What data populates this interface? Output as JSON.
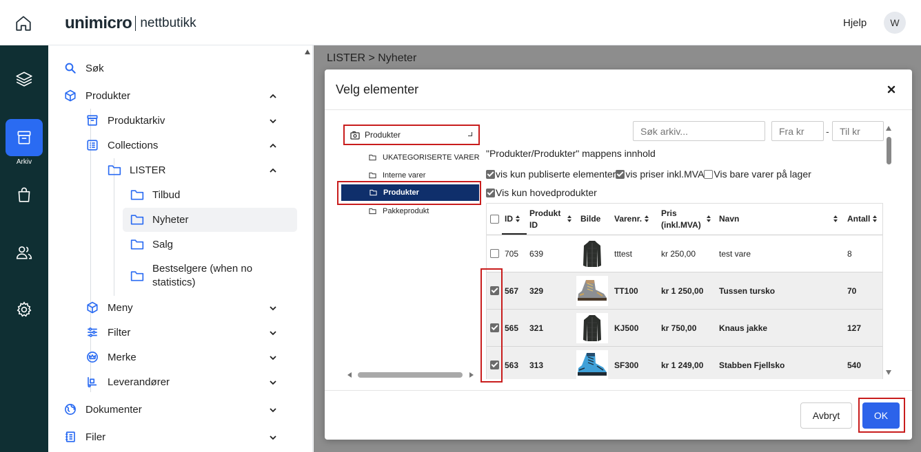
{
  "app": {
    "logo_brand": "unimicro",
    "logo_sub": "nettbutikk",
    "help_label": "Hjelp",
    "avatar_initial": "W"
  },
  "rail": {
    "active_label": "Arkiv"
  },
  "sidebar": {
    "search": "Søk",
    "produkter": "Produkter",
    "produktarkiv": "Produktarkiv",
    "collections": "Collections",
    "lister": "LISTER",
    "tilbud": "Tilbud",
    "nyheter": "Nyheter",
    "salg": "Salg",
    "bestselgere": "Bestselgere (when no statistics)",
    "meny": "Meny",
    "filter": "Filter",
    "merke": "Merke",
    "leverandorer": "Leverandører",
    "dokumenter": "Dokumenter",
    "filer": "Filer"
  },
  "main": {
    "breadcrumb": "LISTER > Nyheter"
  },
  "modal": {
    "title": "Velg elementer",
    "tree": {
      "root": "Produkter",
      "items": [
        "UKATEGORISERTE VARER",
        "Interne varer",
        "Produkter",
        "Pakkeprodukt"
      ]
    },
    "search_placeholder": "Søk arkiv...",
    "price_from_placeholder": "Fra kr",
    "price_dash": "-",
    "price_to_placeholder": "Til kr",
    "folder_caption": "\"Produkter/Produkter\" mappens innhold",
    "options": {
      "published": "vis kun publiserte elementer",
      "incl_vat": "vis priser inkl.MVA",
      "in_stock": "Vis bare varer på lager",
      "main_only": "Vis kun hovedprodukter"
    },
    "columns": {
      "id": "ID",
      "produkt_id_1": "Produkt",
      "produkt_id_2": "ID",
      "bilde": "Bilde",
      "varenr": "Varenr.",
      "pris_1": "Pris",
      "pris_2": "(inkl.MVA)",
      "navn": "Navn",
      "antall": "Antall"
    },
    "rows": [
      {
        "id": "705",
        "produkt_id": "639",
        "varenr": "tttest",
        "pris": "kr 250,00",
        "navn": "test vare",
        "antall": "8"
      },
      {
        "id": "567",
        "produkt_id": "329",
        "varenr": "TT100",
        "pris": "kr 1 250,00",
        "navn": "Tussen tursko",
        "antall": "70"
      },
      {
        "id": "565",
        "produkt_id": "321",
        "varenr": "KJ500",
        "pris": "kr 750,00",
        "navn": "Knaus jakke",
        "antall": "127"
      },
      {
        "id": "563",
        "produkt_id": "313",
        "varenr": "SF300",
        "pris": "kr 1 249,00",
        "navn": "Stabben Fjellsko",
        "antall": "540"
      }
    ],
    "cancel_label": "Avbryt",
    "ok_label": "OK"
  }
}
